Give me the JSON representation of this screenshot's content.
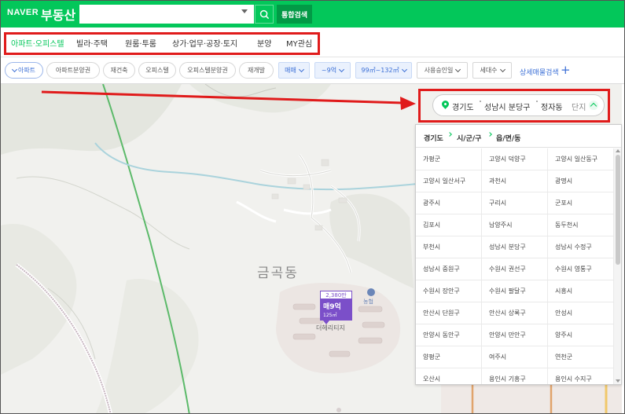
{
  "header": {
    "logo": "NAVER",
    "brand": "부동산",
    "search_value": "",
    "unified_search": "통합검색",
    "icons": [
      "search-icon",
      "caret-down-icon"
    ]
  },
  "tabs": [
    {
      "label": "아파트·오피스텔",
      "active": true
    },
    {
      "label": "빌라·주택",
      "active": false
    },
    {
      "label": "원룸·투룸",
      "active": false
    },
    {
      "label": "상가·업무·공장·토지",
      "active": false
    },
    {
      "label": "분양",
      "active": false
    },
    {
      "label": "MY관심",
      "active": false
    }
  ],
  "filters": {
    "chips": [
      "아파트",
      "아파트분양권",
      "재건축",
      "오피스텔",
      "오피스텔분양권",
      "재개발"
    ],
    "dropdowns": [
      "매매",
      "~9억",
      "99㎡~132㎡",
      "사용승인일",
      "세대수"
    ],
    "detail_search": "상세매물검색",
    "plus": "+"
  },
  "location": {
    "province": "경기도",
    "city": "성남시 분당구",
    "dong": "정자동",
    "complex": "단지"
  },
  "panel": {
    "crumbs": [
      "경기도",
      "시/군/구",
      "읍/면/동"
    ],
    "regions": [
      "가평군",
      "고양시 덕양구",
      "고양시 일산동구",
      "고양시 일산서구",
      "과천시",
      "광명시",
      "광주시",
      "구리시",
      "군포시",
      "김포시",
      "남양주시",
      "동두천시",
      "부천시",
      "성남시 분당구",
      "성남시 수정구",
      "성남시 중원구",
      "수원시 권선구",
      "수원시 영통구",
      "수원시 장안구",
      "수원시 팔달구",
      "시흥시",
      "안산시 단원구",
      "안산시 상록구",
      "안성시",
      "안양시 동안구",
      "안양시 만안구",
      "양주시",
      "양평군",
      "여주시",
      "연천군",
      "오산시",
      "용인시 기흥구",
      "용인시 수지구"
    ]
  },
  "map": {
    "place": "금곡동",
    "facility": "농협",
    "apartment": "더헤리티지",
    "price_marker": {
      "count": "2,380만",
      "price": "매9억",
      "area": "125㎡"
    }
  },
  "colors": {
    "brand": "#03c75a",
    "highlight": "#e01b1b",
    "marker": "#7b4fc9",
    "filter_blue": "#3b6fd6"
  }
}
